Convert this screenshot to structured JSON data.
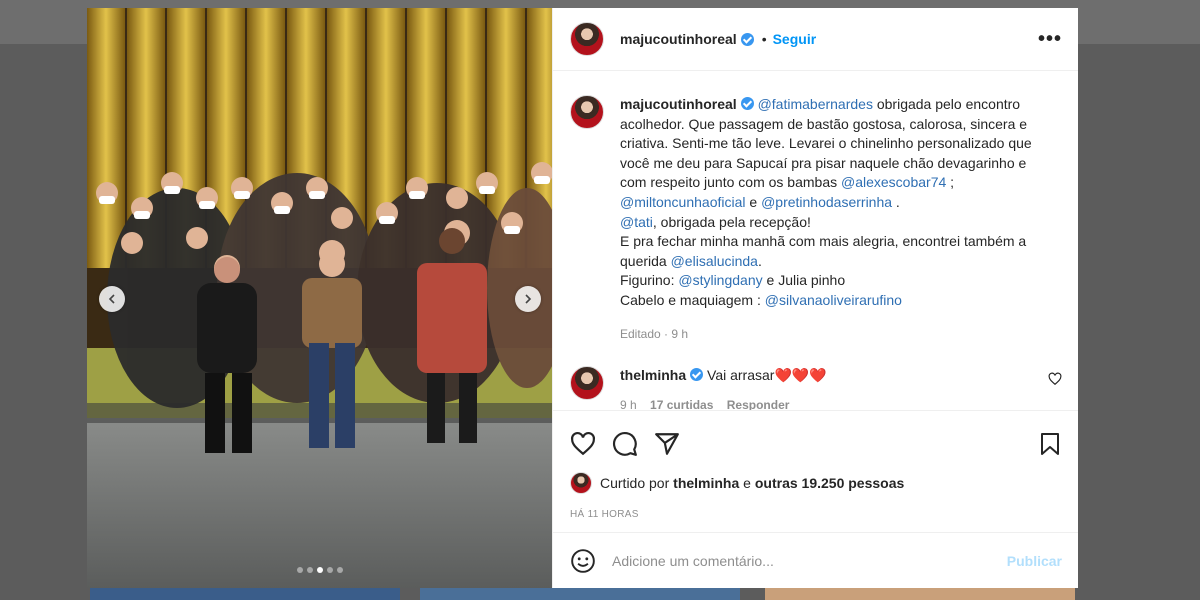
{
  "post": {
    "username": "majucoutinhoreal",
    "follow_label": "Seguir",
    "separator": "•",
    "more_label": "•••",
    "carousel_dots": 5,
    "active_dot": 3
  },
  "caption": {
    "username": "majucoutinhoreal",
    "segments": [
      {
        "text": "@fatimabernardes",
        "mention": true
      },
      {
        "text": " obrigada pelo encontro acolhedor. Que passagem de bastão gostosa, calorosa, sincera e criativa. Senti-me tão leve. Levarei o chinelinho personalizado que você me deu para Sapucaí pra pisar naquele chão devagarinho e com respeito junto com os bambas ",
        "mention": false
      },
      {
        "text": "@alexescobar74",
        "mention": true
      },
      {
        "text": " ;",
        "mention": false
      },
      {
        "br": true
      },
      {
        "text": "@miltoncunhaoficial",
        "mention": true
      },
      {
        "text": " e ",
        "mention": false
      },
      {
        "text": "@pretinhodaserrinha",
        "mention": true
      },
      {
        "text": " .",
        "mention": false
      },
      {
        "br": true
      },
      {
        "text": "@tati",
        "mention": true
      },
      {
        "text": ", obrigada pela recepção!",
        "mention": false
      },
      {
        "br": true
      },
      {
        "text": "E pra fechar minha manhã com mais alegria, encontrei também a querida ",
        "mention": false
      },
      {
        "text": "@elisalucinda",
        "mention": true
      },
      {
        "text": ".",
        "mention": false
      },
      {
        "br": true
      },
      {
        "text": "Figurino: ",
        "mention": false
      },
      {
        "text": "@stylingdany",
        "mention": true
      },
      {
        "text": " e Julia pinho",
        "mention": false
      },
      {
        "br": true
      },
      {
        "text": "Cabelo e maquiagem : ",
        "mention": false
      },
      {
        "text": "@silvanaoliveirarufino",
        "mention": true
      }
    ],
    "edited": "Editado · 9 h"
  },
  "comment": {
    "username": "thelminha",
    "text": "Vai arrasar",
    "hearts": "❤️❤️❤️",
    "time": "9 h",
    "likes": "17 curtidas",
    "reply_label": "Responder"
  },
  "likes": {
    "prefix": "Curtido por",
    "user": "thelminha",
    "middle": "e",
    "others": "outras 19.250 pessoas"
  },
  "time_ago": "HÁ 11 HORAS",
  "comment_box": {
    "placeholder": "Adicione um comentário...",
    "publish_label": "Publicar"
  },
  "colors": {
    "accent": "#0095f6",
    "mention": "#00376b",
    "muted": "#8e8e8e",
    "publish_disabled": "#b2dffc"
  }
}
